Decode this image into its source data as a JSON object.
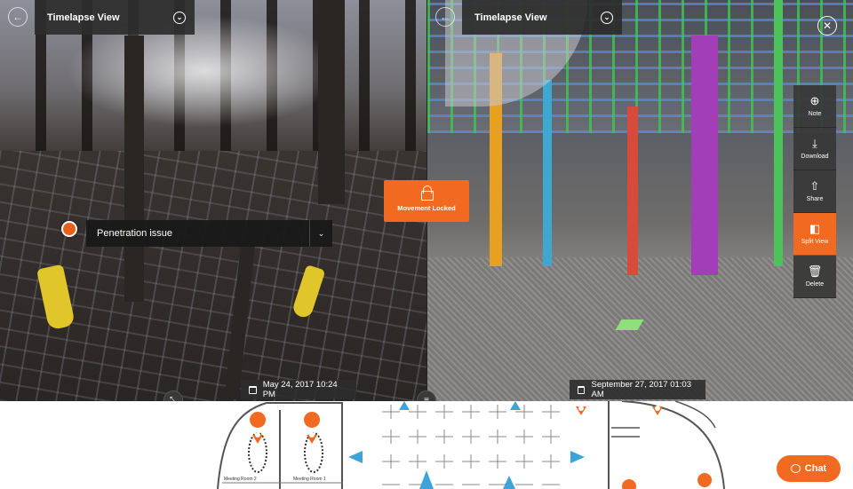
{
  "left_view": {
    "header_title": "Timelapse View",
    "date": "May 24, 2017 10:24 PM",
    "issue_label": "Penetration issue"
  },
  "right_view": {
    "header_title": "Timelapse View",
    "date": "September 27, 2017 01:03 AM"
  },
  "movement_locked_label": "Movement Locked",
  "toolbar": {
    "items": [
      {
        "label": "Note",
        "icon": "note-add-icon"
      },
      {
        "label": "Download",
        "icon": "download-icon"
      },
      {
        "label": "Share",
        "icon": "share-icon"
      },
      {
        "label": "Split View",
        "icon": "split-view-icon",
        "active": true
      },
      {
        "label": "Delete",
        "icon": "trash-icon"
      }
    ]
  },
  "map": {
    "rooms": [
      "Meeting Room 2",
      "Meeting Room 1"
    ]
  },
  "chat_label": "Chat",
  "colors": {
    "accent": "#f26a21",
    "panel": "#2d2d2d"
  }
}
